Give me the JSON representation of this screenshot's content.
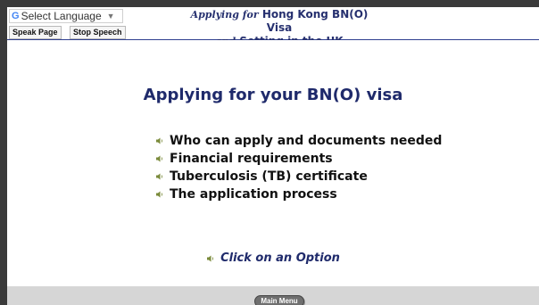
{
  "translate": {
    "label": "Select Language",
    "logo": "G",
    "arrow": "▼"
  },
  "speech": {
    "speak_label": "Speak Page",
    "stop_label": "Stop Speech"
  },
  "title": {
    "line1_prefix": "Applying for",
    "line1_main": "Hong Kong BN(O) Visa",
    "line2_prefix": "and",
    "line2_main": "Setting in the UK"
  },
  "main": {
    "heading": "Applying for your BN(O) visa",
    "items": [
      {
        "label": "Who can apply and documents needed"
      },
      {
        "label": "Financial requirements"
      },
      {
        "label": "Tuberculosis (TB) certificate"
      },
      {
        "label": "The application process"
      }
    ],
    "prompt": "Click on an Option"
  },
  "footer": {
    "main_menu_label": "Main Menu"
  },
  "colors": {
    "accent": "#26306f",
    "speaker_icon": "#7a8a3a",
    "footer_bg": "#d6d6d6"
  },
  "icons": {
    "bullet": "speaker-icon"
  }
}
